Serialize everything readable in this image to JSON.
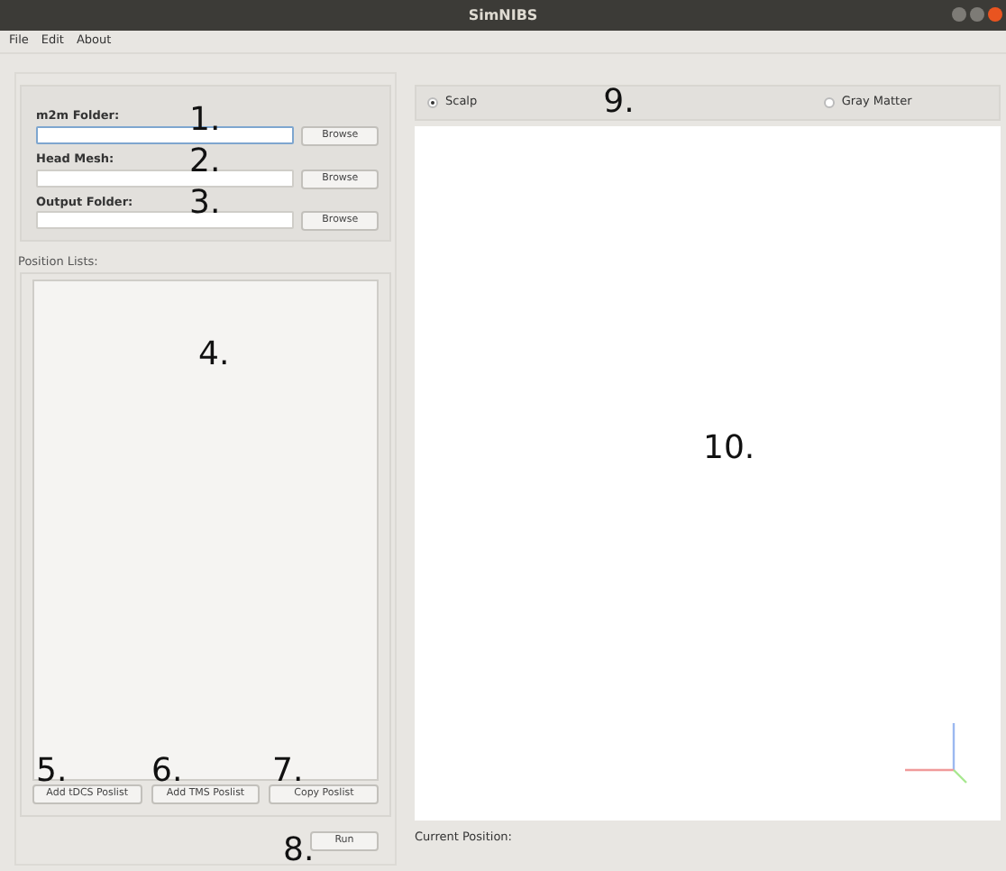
{
  "window": {
    "title": "SimNIBS"
  },
  "menu": [
    "File",
    "Edit",
    "About"
  ],
  "fields": [
    {
      "label": "m2m Folder:",
      "focused": true,
      "button": "Browse",
      "annotation": "1."
    },
    {
      "label": "Head Mesh:",
      "focused": false,
      "button": "Browse",
      "annotation": "2."
    },
    {
      "label": "Output Folder:",
      "focused": false,
      "button": "Browse",
      "annotation": "3."
    }
  ],
  "position_lists": {
    "label": "Position Lists:",
    "annotation": "4."
  },
  "poslist_buttons": [
    {
      "label": "Add tDCS Poslist",
      "annotation": "5."
    },
    {
      "label": "Add TMS Poslist",
      "annotation": "6."
    },
    {
      "label": "Copy Poslist",
      "annotation": "7."
    }
  ],
  "run": {
    "label": "Run",
    "annotation": "8."
  },
  "surface": {
    "options": [
      {
        "label": "Scalp",
        "selected": true
      },
      {
        "label": "Gray Matter",
        "selected": false
      }
    ],
    "annotation": "9."
  },
  "viewer": {
    "annotation": "10."
  },
  "status": {
    "label": "Current Position:"
  }
}
